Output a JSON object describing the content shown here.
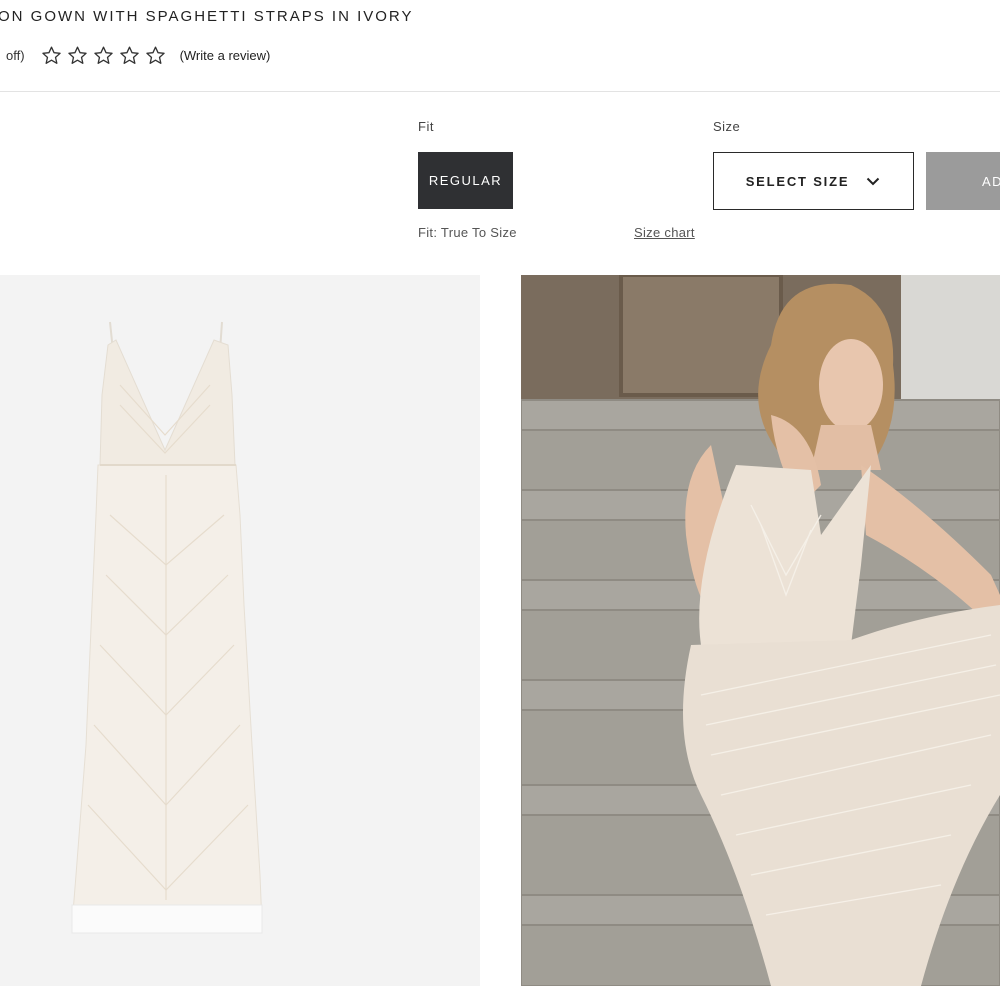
{
  "product": {
    "title": "ON GOWN WITH SPAGHETTI STRAPS IN IVORY",
    "discount_text": "off)",
    "rating_stars": 0,
    "rating_max": 5,
    "review_link": "(Write a review)"
  },
  "options": {
    "fit_label": "Fit",
    "fit_selected": "REGULAR",
    "size_label": "Size",
    "size_placeholder": "SELECT SIZE",
    "add_button": "AD",
    "fit_note": "Fit: True To Size",
    "size_chart_link": "Size chart"
  },
  "gallery": [
    {
      "name": "product-flat-image"
    },
    {
      "name": "model-lifestyle-image"
    }
  ],
  "colors": {
    "primary_dark": "#2f3033",
    "disabled_button": "#9b9b9b",
    "image_bg": "#f3f3f3",
    "dress_ivory": "#f4eee6"
  }
}
